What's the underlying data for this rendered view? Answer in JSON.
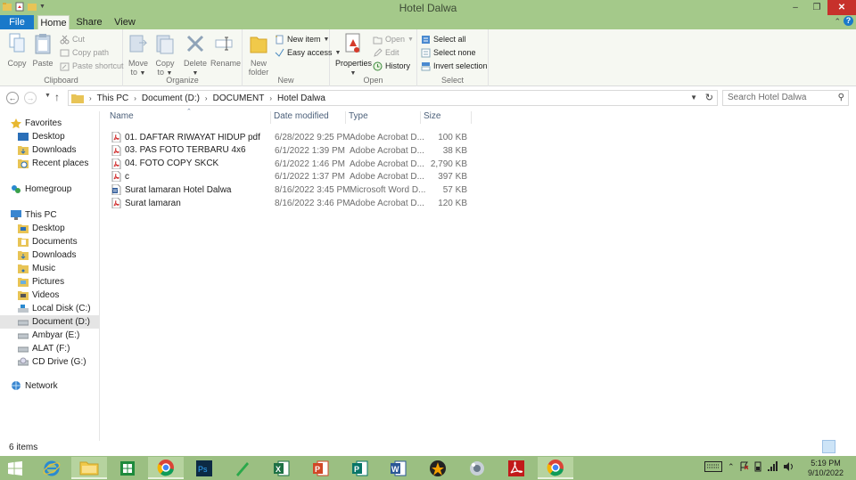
{
  "window": {
    "title": "Hotel Dalwa",
    "controls": {
      "minimize": "–",
      "restore": "❐",
      "close": "✕"
    }
  },
  "ribbon": {
    "tabs": [
      "File",
      "Home",
      "Share",
      "View"
    ],
    "help": "?",
    "clipboard": {
      "copy": "Copy",
      "paste": "Paste",
      "cut": "Cut",
      "copy_path": "Copy path",
      "paste_shortcut": "Paste shortcut",
      "label": "Clipboard"
    },
    "organize": {
      "move_to": "Move",
      "move_to_2": "to",
      "copy_to": "Copy",
      "copy_to_2": "to",
      "delete": "Delete",
      "rename": "Rename",
      "label": "Organize"
    },
    "new": {
      "new_folder": "New",
      "new_folder_2": "folder",
      "new_item": "New item",
      "easy_access": "Easy access",
      "label": "New"
    },
    "open": {
      "properties": "Properties",
      "open": "Open",
      "edit": "Edit",
      "history": "History",
      "label": "Open"
    },
    "select": {
      "select_all": "Select all",
      "select_none": "Select none",
      "invert_selection": "Invert selection",
      "label": "Select"
    }
  },
  "address": {
    "crumbs": [
      "This PC",
      "Document (D:)",
      "DOCUMENT",
      "Hotel Dalwa"
    ],
    "search_placeholder": "Search Hotel Dalwa"
  },
  "navigation": {
    "favorites": "Favorites",
    "favorites_items": [
      "Desktop",
      "Downloads",
      "Recent places"
    ],
    "homegroup": "Homegroup",
    "this_pc": "This PC",
    "this_pc_items": [
      "Desktop",
      "Documents",
      "Downloads",
      "Music",
      "Pictures",
      "Videos",
      "Local Disk (C:)",
      "Document (D:)",
      "Ambyar (E:)",
      "ALAT (F:)",
      "CD Drive (G:)"
    ],
    "network": "Network"
  },
  "columns": {
    "name": "Name",
    "date_modified": "Date modified",
    "type": "Type",
    "size": "Size"
  },
  "files": [
    {
      "name": "01. DAFTAR RIWAYAT HIDUP pdf",
      "date": "6/28/2022 9:25 PM",
      "type": "Adobe Acrobat D...",
      "size": "100 KB",
      "icon": "pdf-icon"
    },
    {
      "name": "03. PAS FOTO TERBARU 4x6",
      "date": "6/1/2022 1:39 PM",
      "type": "Adobe Acrobat D...",
      "size": "38 KB",
      "icon": "pdf-icon"
    },
    {
      "name": "04. FOTO COPY SKCK",
      "date": "6/1/2022 1:46 PM",
      "type": "Adobe Acrobat D...",
      "size": "2,790 KB",
      "icon": "pdf-icon"
    },
    {
      "name": "c",
      "date": "6/1/2022 1:37 PM",
      "type": "Adobe Acrobat D...",
      "size": "397 KB",
      "icon": "pdf-icon"
    },
    {
      "name": "Surat lamaran Hotel Dalwa",
      "date": "8/16/2022 3:45 PM",
      "type": "Microsoft Word D...",
      "size": "57 KB",
      "icon": "word-doc-icon"
    },
    {
      "name": "Surat lamaran",
      "date": "8/16/2022 3:46 PM",
      "type": "Adobe Acrobat D...",
      "size": "120 KB",
      "icon": "pdf-icon"
    }
  ],
  "status": {
    "item_count": "6 items"
  },
  "taskbar": {
    "apps": [
      "internet-explorer",
      "file-explorer",
      "excel-green",
      "chrome",
      "photoshop",
      "pen-tool",
      "excel",
      "powerpoint",
      "publisher",
      "word",
      "winamp",
      "utility",
      "acrobat",
      "chrome"
    ],
    "clock_time": "5:19 PM",
    "clock_date": "9/10/2022"
  },
  "colors": {
    "titlebar": "#a4c98a",
    "file_tab": "#1979ca",
    "taskbar": "#9bbf82",
    "pdf_red": "#d12f2f",
    "word_blue": "#2b5797"
  }
}
